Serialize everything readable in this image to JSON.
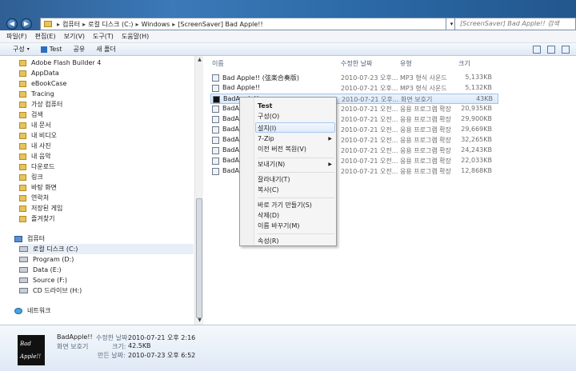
{
  "window": {
    "address": [
      "컴퓨터",
      "로컬 디스크 (C:)",
      "Windows",
      "[ScreenSaver] Bad Apple!!"
    ],
    "search_placeholder": "[ScreenSaver] Bad Apple!! 검색"
  },
  "menubar": [
    "파일(F)",
    "편집(E)",
    "보기(V)",
    "도구(T)",
    "도움말(H)"
  ],
  "toolbar": {
    "organize": "구성",
    "test": "Test",
    "share": "공유",
    "new_folder": "새 폴더"
  },
  "nav": {
    "folders": [
      "Adobe Flash Builder 4",
      "AppData",
      "eBookCase",
      "Tracing",
      "가상 컴퓨터",
      "검색",
      "내 문서",
      "내 비디오",
      "내 사진",
      "내 음악",
      "다운로드",
      "링크",
      "바탕 화면",
      "연락처",
      "저장된 게임",
      "즐겨찾기"
    ],
    "computer": "컴퓨터",
    "drives": [
      "로컬 디스크 (C:)",
      "Program (D:)",
      "Data (E:)",
      "Source (F:)",
      "CD 드라이브 (H:)"
    ],
    "network": "네트워크"
  },
  "columns": {
    "name": "이름",
    "date": "수정한 날짜",
    "type": "유형",
    "size": "크기"
  },
  "files": [
    {
      "name": "Bad Apple!! (弦楽合奏版)",
      "date": "2010-07-23 오후...",
      "type": "MP3 형식 사운드",
      "size": "5,133KB"
    },
    {
      "name": "Bad Apple!!",
      "date": "2010-07-21 오후...",
      "type": "MP3 형식 사운드",
      "size": "5,132KB"
    },
    {
      "name": "BadApple!!",
      "date": "2010-07-21 오후...",
      "type": "화면 보호기",
      "size": "43KB"
    },
    {
      "name": "BadApp",
      "date": "2010-07-21 오전...",
      "type": "응용 프로그램 확장",
      "size": "20,935KB"
    },
    {
      "name": "BadApp",
      "date": "2010-07-21 오전...",
      "type": "응용 프로그램 확장",
      "size": "29,900KB"
    },
    {
      "name": "BadApp",
      "date": "2010-07-21 오전...",
      "type": "응용 프로그램 확장",
      "size": "29,669KB"
    },
    {
      "name": "BadApp",
      "date": "2010-07-21 오전...",
      "type": "응용 프로그램 확장",
      "size": "32,265KB"
    },
    {
      "name": "BadApp",
      "date": "2010-07-21 오전...",
      "type": "응용 프로그램 확장",
      "size": "24,243KB"
    },
    {
      "name": "BadApp",
      "date": "2010-07-21 오전...",
      "type": "응용 프로그램 확장",
      "size": "22,033KB"
    },
    {
      "name": "BadApp",
      "date": "2010-07-21 오전...",
      "type": "응용 프로그램 확장",
      "size": "12,868KB"
    }
  ],
  "context_menu": {
    "test": "Test",
    "configure": "구성(O)",
    "install": "설치(I)",
    "zip": "7-Zip",
    "restore": "이전 버전 복원(V)",
    "send_to": "보내기(N)",
    "cut": "잘라내기(T)",
    "copy": "복사(C)",
    "shortcut": "바로 가기 만들기(S)",
    "delete": "삭제(D)",
    "rename": "이름 바꾸기(M)",
    "properties": "속성(R)"
  },
  "details": {
    "name": "BadApple!!",
    "type": "화면 보호기",
    "modified_label": "수정한 날짜:",
    "modified": "2010-07-21 오후 2:16",
    "size_label": "크기:",
    "size": "42.5KB",
    "created_label": "만든 날짜:",
    "created": "2010-07-23 오후 6:52",
    "thumb_text1": "Bad",
    "thumb_text2": "Apple!!"
  }
}
